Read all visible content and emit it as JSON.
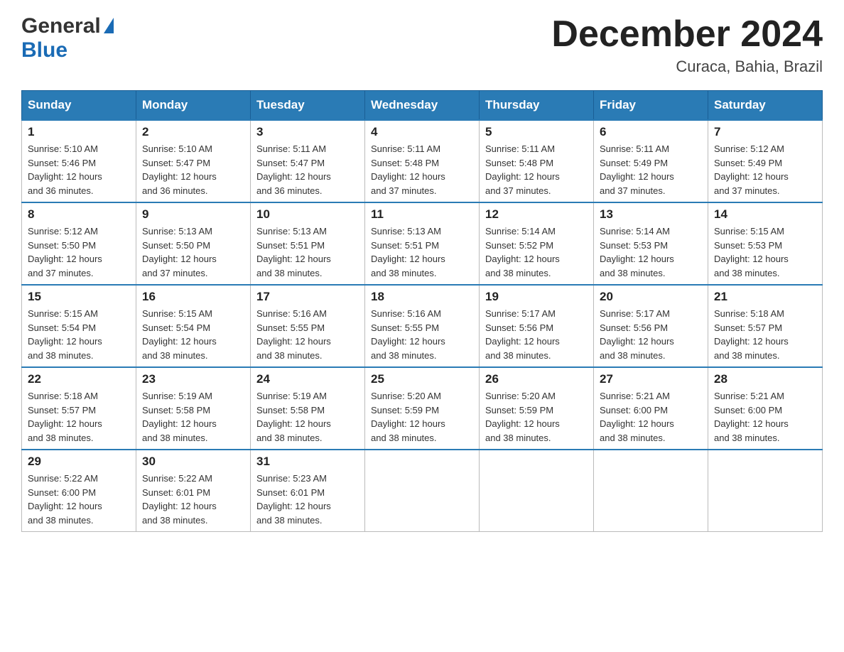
{
  "header": {
    "logo_general": "General",
    "logo_blue": "Blue",
    "month_title": "December 2024",
    "location": "Curaca, Bahia, Brazil"
  },
  "days_of_week": [
    "Sunday",
    "Monday",
    "Tuesday",
    "Wednesday",
    "Thursday",
    "Friday",
    "Saturday"
  ],
  "weeks": [
    [
      {
        "day": "1",
        "sunrise": "5:10 AM",
        "sunset": "5:46 PM",
        "daylight": "12 hours and 36 minutes."
      },
      {
        "day": "2",
        "sunrise": "5:10 AM",
        "sunset": "5:47 PM",
        "daylight": "12 hours and 36 minutes."
      },
      {
        "day": "3",
        "sunrise": "5:11 AM",
        "sunset": "5:47 PM",
        "daylight": "12 hours and 36 minutes."
      },
      {
        "day": "4",
        "sunrise": "5:11 AM",
        "sunset": "5:48 PM",
        "daylight": "12 hours and 37 minutes."
      },
      {
        "day": "5",
        "sunrise": "5:11 AM",
        "sunset": "5:48 PM",
        "daylight": "12 hours and 37 minutes."
      },
      {
        "day": "6",
        "sunrise": "5:11 AM",
        "sunset": "5:49 PM",
        "daylight": "12 hours and 37 minutes."
      },
      {
        "day": "7",
        "sunrise": "5:12 AM",
        "sunset": "5:49 PM",
        "daylight": "12 hours and 37 minutes."
      }
    ],
    [
      {
        "day": "8",
        "sunrise": "5:12 AM",
        "sunset": "5:50 PM",
        "daylight": "12 hours and 37 minutes."
      },
      {
        "day": "9",
        "sunrise": "5:13 AM",
        "sunset": "5:50 PM",
        "daylight": "12 hours and 37 minutes."
      },
      {
        "day": "10",
        "sunrise": "5:13 AM",
        "sunset": "5:51 PM",
        "daylight": "12 hours and 38 minutes."
      },
      {
        "day": "11",
        "sunrise": "5:13 AM",
        "sunset": "5:51 PM",
        "daylight": "12 hours and 38 minutes."
      },
      {
        "day": "12",
        "sunrise": "5:14 AM",
        "sunset": "5:52 PM",
        "daylight": "12 hours and 38 minutes."
      },
      {
        "day": "13",
        "sunrise": "5:14 AM",
        "sunset": "5:53 PM",
        "daylight": "12 hours and 38 minutes."
      },
      {
        "day": "14",
        "sunrise": "5:15 AM",
        "sunset": "5:53 PM",
        "daylight": "12 hours and 38 minutes."
      }
    ],
    [
      {
        "day": "15",
        "sunrise": "5:15 AM",
        "sunset": "5:54 PM",
        "daylight": "12 hours and 38 minutes."
      },
      {
        "day": "16",
        "sunrise": "5:15 AM",
        "sunset": "5:54 PM",
        "daylight": "12 hours and 38 minutes."
      },
      {
        "day": "17",
        "sunrise": "5:16 AM",
        "sunset": "5:55 PM",
        "daylight": "12 hours and 38 minutes."
      },
      {
        "day": "18",
        "sunrise": "5:16 AM",
        "sunset": "5:55 PM",
        "daylight": "12 hours and 38 minutes."
      },
      {
        "day": "19",
        "sunrise": "5:17 AM",
        "sunset": "5:56 PM",
        "daylight": "12 hours and 38 minutes."
      },
      {
        "day": "20",
        "sunrise": "5:17 AM",
        "sunset": "5:56 PM",
        "daylight": "12 hours and 38 minutes."
      },
      {
        "day": "21",
        "sunrise": "5:18 AM",
        "sunset": "5:57 PM",
        "daylight": "12 hours and 38 minutes."
      }
    ],
    [
      {
        "day": "22",
        "sunrise": "5:18 AM",
        "sunset": "5:57 PM",
        "daylight": "12 hours and 38 minutes."
      },
      {
        "day": "23",
        "sunrise": "5:19 AM",
        "sunset": "5:58 PM",
        "daylight": "12 hours and 38 minutes."
      },
      {
        "day": "24",
        "sunrise": "5:19 AM",
        "sunset": "5:58 PM",
        "daylight": "12 hours and 38 minutes."
      },
      {
        "day": "25",
        "sunrise": "5:20 AM",
        "sunset": "5:59 PM",
        "daylight": "12 hours and 38 minutes."
      },
      {
        "day": "26",
        "sunrise": "5:20 AM",
        "sunset": "5:59 PM",
        "daylight": "12 hours and 38 minutes."
      },
      {
        "day": "27",
        "sunrise": "5:21 AM",
        "sunset": "6:00 PM",
        "daylight": "12 hours and 38 minutes."
      },
      {
        "day": "28",
        "sunrise": "5:21 AM",
        "sunset": "6:00 PM",
        "daylight": "12 hours and 38 minutes."
      }
    ],
    [
      {
        "day": "29",
        "sunrise": "5:22 AM",
        "sunset": "6:00 PM",
        "daylight": "12 hours and 38 minutes."
      },
      {
        "day": "30",
        "sunrise": "5:22 AM",
        "sunset": "6:01 PM",
        "daylight": "12 hours and 38 minutes."
      },
      {
        "day": "31",
        "sunrise": "5:23 AM",
        "sunset": "6:01 PM",
        "daylight": "12 hours and 38 minutes."
      },
      null,
      null,
      null,
      null
    ]
  ],
  "labels": {
    "sunrise": "Sunrise:",
    "sunset": "Sunset:",
    "daylight": "Daylight:"
  }
}
